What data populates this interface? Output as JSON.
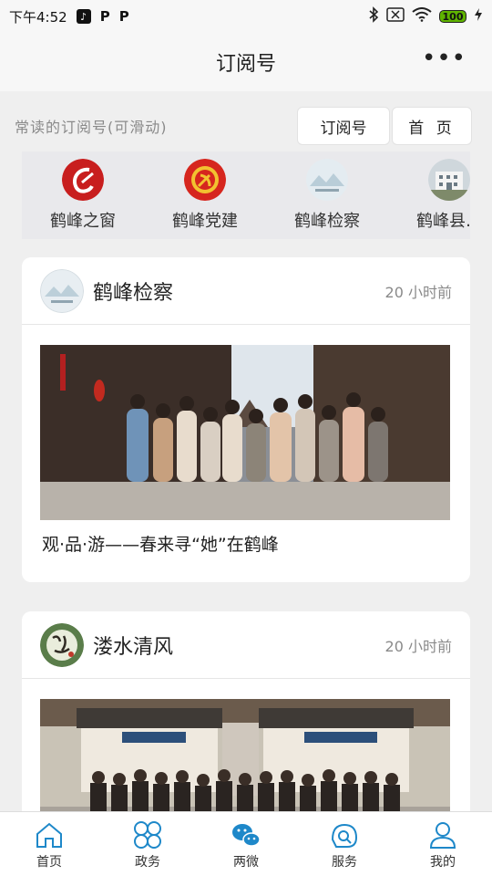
{
  "status": {
    "time": "下午4:52",
    "apps": [
      "tiktok-icon",
      "parking-icon",
      "parking-icon"
    ],
    "battery": "100"
  },
  "header": {
    "title": "订阅号",
    "more_glyph": "•••"
  },
  "frequent": {
    "label": "常读的订阅号(可滑动)",
    "tab_subscriptions": "订阅号",
    "tab_home": "首 页"
  },
  "subscriptions": [
    {
      "name": "鹤峰之窗",
      "icon": "brand-red-icon"
    },
    {
      "name": "鹤峰党建",
      "icon": "party-emblem-icon"
    },
    {
      "name": "鹤峰检察",
      "icon": "mountain-landscape-icon"
    },
    {
      "name": "鹤峰县…",
      "icon": "building-icon"
    }
  ],
  "articles": [
    {
      "account": "鹤峰检察",
      "time": "20 小时前",
      "caption": "观·品·游——春来寻“她”在鹤峰",
      "image": "group-photo"
    },
    {
      "account": "溇水清风",
      "time": "20 小时前",
      "caption": "",
      "image": "group-photo"
    }
  ],
  "nav": [
    {
      "label": "首页",
      "icon": "home-icon"
    },
    {
      "label": "政务",
      "icon": "government-icon"
    },
    {
      "label": "两微",
      "icon": "wechat-weibo-icon"
    },
    {
      "label": "服务",
      "icon": "service-icon"
    },
    {
      "label": "我的",
      "icon": "user-icon"
    }
  ],
  "colors": {
    "accent": "#1e88c9",
    "card_bg": "#ffffff",
    "page_bg": "#efefef",
    "strip_bg": "#e9e9ec"
  }
}
